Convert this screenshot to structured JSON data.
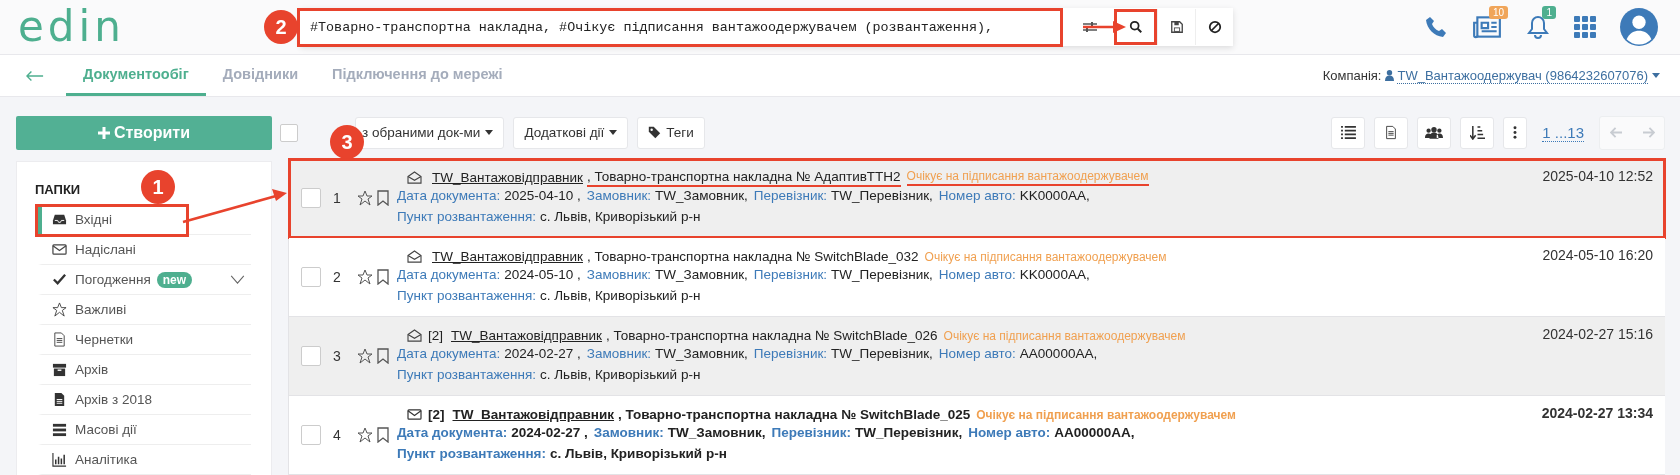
{
  "header": {
    "logo": "edin",
    "search": {
      "value": "#Товарно-транспортна накладна, #Очікує підписання вантажоодержувачем (розвантаження),",
      "annotation": "2",
      "search_button_highlighted": true
    },
    "news_badge": "10",
    "notification_badge": "1"
  },
  "nav": {
    "tabs": [
      {
        "label": "Документообіг",
        "selected": true
      },
      {
        "label": "Довідники",
        "selected": false
      },
      {
        "label": "Підключення до мережі",
        "selected": false
      }
    ],
    "company_label": "Компанія:",
    "company": "TW_Вантажоодержувач (9864232607076)"
  },
  "sidebar": {
    "create_label": "Створити",
    "folders_title": "ПАПКИ",
    "items": [
      {
        "label": "Вхідні",
        "kind": "inbox",
        "selected": true,
        "annotation": "1"
      },
      {
        "label": "Надіслані",
        "kind": "envelope",
        "selected": false
      },
      {
        "label": "Погодження",
        "kind": "check",
        "selected": false,
        "badge": "new",
        "expanded": false
      },
      {
        "label": "Важливі",
        "kind": "star",
        "selected": false
      },
      {
        "label": "Чернетки",
        "kind": "file",
        "selected": false
      },
      {
        "label": "Архів",
        "kind": "archive",
        "selected": false
      },
      {
        "label": "Архів з 2018",
        "kind": "file-filled",
        "selected": false
      },
      {
        "label": "Масові дії",
        "kind": "stack",
        "selected": false
      },
      {
        "label": "Аналітика",
        "kind": "chart",
        "selected": false
      }
    ]
  },
  "toolbar": {
    "select_all_checked": false,
    "actions": [
      {
        "label": "з обраними док-ми",
        "kind": "dropdown"
      },
      {
        "label": "Додаткові дії",
        "kind": "dropdown"
      },
      {
        "label": "Теги",
        "kind": "tag"
      }
    ],
    "pagination": "1 ...13"
  },
  "rows": [
    {
      "number": "1",
      "checked": false,
      "starred": false,
      "bookmarked": false,
      "unread": false,
      "annotation": "3",
      "underlined": true,
      "sender": "TW_Вантажовідправник",
      "title": ", Товарно-транспортна накладна № АдаптивТТН2",
      "status": "Очікує на підписання вантажоодержувачем",
      "fields": [
        {
          "label": "Дата документа:",
          "value": "2025-04-10 ,"
        },
        {
          "label": "Замовник:",
          "value": "TW_Замовник,"
        },
        {
          "label": "Перевізник:",
          "value": "TW_Перевізник,"
        },
        {
          "label": "Номер авто:",
          "value": "KK0000AA,"
        }
      ],
      "place_label": "Пункт розвантаження:",
      "place": "с. Львів, Криворізький р-н",
      "date": "2025-04-10 12:52"
    },
    {
      "number": "2",
      "checked": false,
      "starred": false,
      "bookmarked": false,
      "unread": false,
      "underlined": false,
      "sender": "TW_Вантажовідправник",
      "title": ", Товарно-транспортна накладна № SwitchBlade_032",
      "status": "Очікує на підписання вантажоодержувачем",
      "fields": [
        {
          "label": "Дата документа:",
          "value": "2024-05-10 ,"
        },
        {
          "label": "Замовник:",
          "value": "TW_Замовник,"
        },
        {
          "label": "Перевізник:",
          "value": "TW_Перевізник,"
        },
        {
          "label": "Номер авто:",
          "value": "KK0000AA,"
        }
      ],
      "place_label": "Пункт розвантаження:",
      "place": "с. Львів, Криворізький р-н",
      "date": "2024-05-10 16:20"
    },
    {
      "number": "3",
      "checked": false,
      "starred": false,
      "bookmarked": false,
      "unread": false,
      "underlined": false,
      "count": "[2]",
      "sender": "TW_Вантажовідправник",
      "title": ", Товарно-транспортна накладна № SwitchBlade_026",
      "status": "Очікує на підписання вантажоодержувачем",
      "fields": [
        {
          "label": "Дата документа:",
          "value": "2024-02-27 ,"
        },
        {
          "label": "Замовник:",
          "value": "TW_Замовник,"
        },
        {
          "label": "Перевізник:",
          "value": "TW_Перевізник,"
        },
        {
          "label": "Номер авто:",
          "value": "AA00000AA,"
        }
      ],
      "place_label": "Пункт розвантаження:",
      "place": "с. Львів, Криворізький р-н",
      "date": "2024-02-27 15:16"
    },
    {
      "number": "4",
      "checked": false,
      "starred": false,
      "bookmarked": false,
      "unread": true,
      "underlined": false,
      "count": "[2]",
      "sender": "TW_Вантажовідправник",
      "title": ", Товарно-транспортна накладна № SwitchBlade_025",
      "status": "Очікує на підписання вантажоодержувачем",
      "fields": [
        {
          "label": "Дата документа:",
          "value": "2024-02-27 ,"
        },
        {
          "label": "Замовник:",
          "value": "TW_Замовник,"
        },
        {
          "label": "Перевізник:",
          "value": "TW_Перевізник,"
        },
        {
          "label": "Номер авто:",
          "value": "AA00000AA,"
        }
      ],
      "place_label": "Пункт розвантаження:",
      "place": "с. Львів, Криворізький р-н",
      "date": "2024-02-27 13:34"
    }
  ]
}
